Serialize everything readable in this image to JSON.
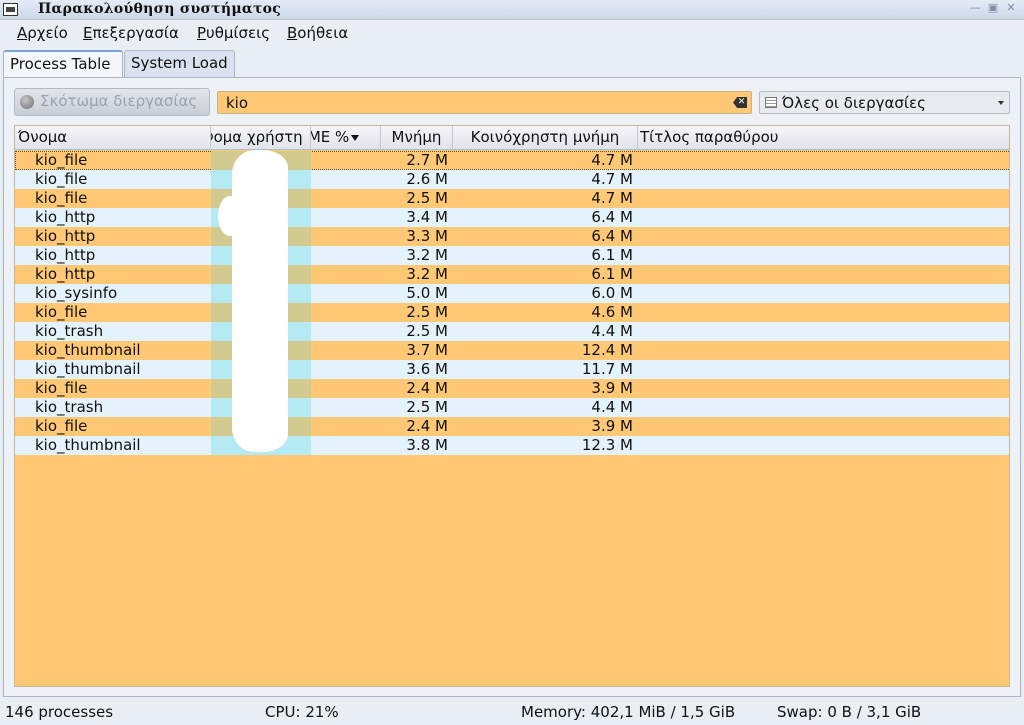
{
  "window": {
    "title": "Παρακολούθηση συστήματος",
    "controls": [
      "minimize",
      "maximize",
      "close"
    ]
  },
  "menu": [
    "Αρχείο",
    "Επεξεργασία",
    "Ρυθμίσεις",
    "Βοήθεια"
  ],
  "tabs": [
    {
      "label": "Process Table",
      "active": true
    },
    {
      "label": "System Load",
      "active": false
    }
  ],
  "toolbar": {
    "kill_label": "Σκότωμα διεργασίας",
    "search_value": "kio",
    "filter_selected": "Όλες οι διεργασίες"
  },
  "table": {
    "columns": [
      "Όνομα",
      "Όνομα χρήστη",
      "ΚΜΕ %",
      "Μνήμη",
      "Κοινόχρηστη μνήμη",
      "Τίτλος παραθύρου"
    ],
    "sort_column": "ΚΜΕ %",
    "rows": [
      {
        "name": "kio_file",
        "memory": "2.7 M",
        "shared": "4.7 M"
      },
      {
        "name": "kio_file",
        "memory": "2.6 M",
        "shared": "4.7 M"
      },
      {
        "name": "kio_file",
        "memory": "2.5 M",
        "shared": "4.7 M"
      },
      {
        "name": "kio_http",
        "memory": "3.4 M",
        "shared": "6.4 M"
      },
      {
        "name": "kio_http",
        "memory": "3.3 M",
        "shared": "6.4 M"
      },
      {
        "name": "kio_http",
        "memory": "3.2 M",
        "shared": "6.1 M"
      },
      {
        "name": "kio_http",
        "memory": "3.2 M",
        "shared": "6.1 M"
      },
      {
        "name": "kio_sysinfo",
        "memory": "5.0 M",
        "shared": "6.0 M"
      },
      {
        "name": "kio_file",
        "memory": "2.5 M",
        "shared": "4.6 M"
      },
      {
        "name": "kio_trash",
        "memory": "2.5 M",
        "shared": "4.4 M"
      },
      {
        "name": "kio_thumbnail",
        "memory": "3.7 M",
        "shared": "12.4 M"
      },
      {
        "name": "kio_thumbnail",
        "memory": "3.6 M",
        "shared": "11.7 M"
      },
      {
        "name": "kio_file",
        "memory": "2.4 M",
        "shared": "3.9 M"
      },
      {
        "name": "kio_trash",
        "memory": "2.5 M",
        "shared": "4.4 M"
      },
      {
        "name": "kio_file",
        "memory": "2.4 M",
        "shared": "3.9 M"
      },
      {
        "name": "kio_thumbnail",
        "memory": "3.8 M",
        "shared": "12.3 M"
      }
    ]
  },
  "status": {
    "processes": "146 processes",
    "cpu": "CPU: 21%",
    "memory": "Memory: 402,1 MiB / 1,5 GiB",
    "swap": "Swap: 0 B / 3,1 GiB"
  }
}
